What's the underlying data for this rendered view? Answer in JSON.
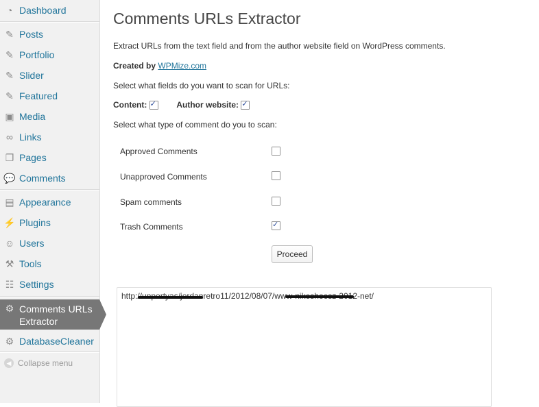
{
  "sidebar": {
    "items": [
      {
        "label": "Dashboard",
        "icon": "dashboard-icon"
      },
      {
        "label": "Posts",
        "icon": "pin-icon"
      },
      {
        "label": "Portfolio",
        "icon": "pin-icon"
      },
      {
        "label": "Slider",
        "icon": "pin-icon"
      },
      {
        "label": "Featured",
        "icon": "pin-icon"
      },
      {
        "label": "Media",
        "icon": "media-icon"
      },
      {
        "label": "Links",
        "icon": "link-icon"
      },
      {
        "label": "Pages",
        "icon": "pages-icon"
      },
      {
        "label": "Comments",
        "icon": "comment-icon"
      },
      {
        "label": "Appearance",
        "icon": "appearance-icon"
      },
      {
        "label": "Plugins",
        "icon": "plugin-icon"
      },
      {
        "label": "Users",
        "icon": "users-icon"
      },
      {
        "label": "Tools",
        "icon": "tools-icon"
      },
      {
        "label": "Settings",
        "icon": "settings-icon"
      },
      {
        "label": "Comments URLs Extractor",
        "label_line1": "Comments URLs",
        "label_line2": "Extractor",
        "icon": "gear-icon"
      },
      {
        "label": "DatabaseCleaner",
        "icon": "gear-icon"
      }
    ],
    "collapse_label": "Collapse menu",
    "current_bg": "#777777",
    "link_color": "#21759b"
  },
  "main": {
    "title": "Comments URLs Extractor",
    "description": "Extract URLs from the text field and from the author website field on WordPress comments.",
    "created_by_label": "Created by",
    "created_by_link": "WPMize.com",
    "fields_prompt": "Select what fields do you want to scan for URLs:",
    "fields": [
      {
        "label": "Content:",
        "checked": true
      },
      {
        "label": "Author website:",
        "checked": true
      }
    ],
    "type_prompt": "Select what type of comment do you to scan:",
    "comment_types": [
      {
        "label": "Approved Comments",
        "checked": false
      },
      {
        "label": "Unapproved Comments",
        "checked": false
      },
      {
        "label": "Spam comments",
        "checked": false
      },
      {
        "label": "Trash Comments",
        "checked": true
      }
    ],
    "proceed_label": "Proceed",
    "results_text": "http://unportyas/jordanretro11/2012/08/07/www-nikeshoesz-2012-net/"
  }
}
